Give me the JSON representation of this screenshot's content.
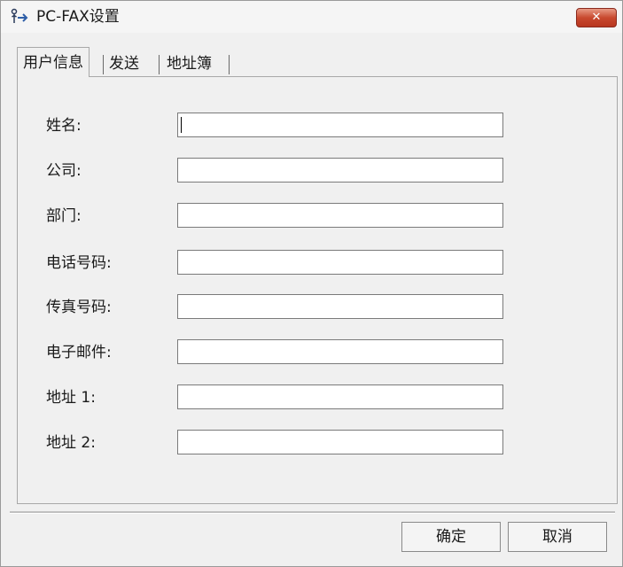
{
  "window": {
    "title": "PC-FAX设置",
    "close_glyph": "✕"
  },
  "tabs": [
    {
      "label": "用户信息",
      "active": true
    },
    {
      "label": "发送",
      "active": false
    },
    {
      "label": "地址簿",
      "active": false
    }
  ],
  "form": {
    "fields": [
      {
        "label": "姓名:",
        "value": ""
      },
      {
        "label": "公司:",
        "value": ""
      },
      {
        "label": "部门:",
        "value": ""
      },
      {
        "label": "电话号码:",
        "value": ""
      },
      {
        "label": "传真号码:",
        "value": ""
      },
      {
        "label": "电子邮件:",
        "value": ""
      },
      {
        "label": "地址 1:",
        "value": ""
      },
      {
        "label": "地址 2:",
        "value": ""
      }
    ]
  },
  "buttons": {
    "ok": "确定",
    "cancel": "取消"
  },
  "colors": {
    "window_bg": "#f0f0f0",
    "close_button": "#c8492f",
    "input_bg": "#ffffff"
  },
  "icons": {
    "app": "fax-send-icon",
    "close": "close-icon"
  }
}
